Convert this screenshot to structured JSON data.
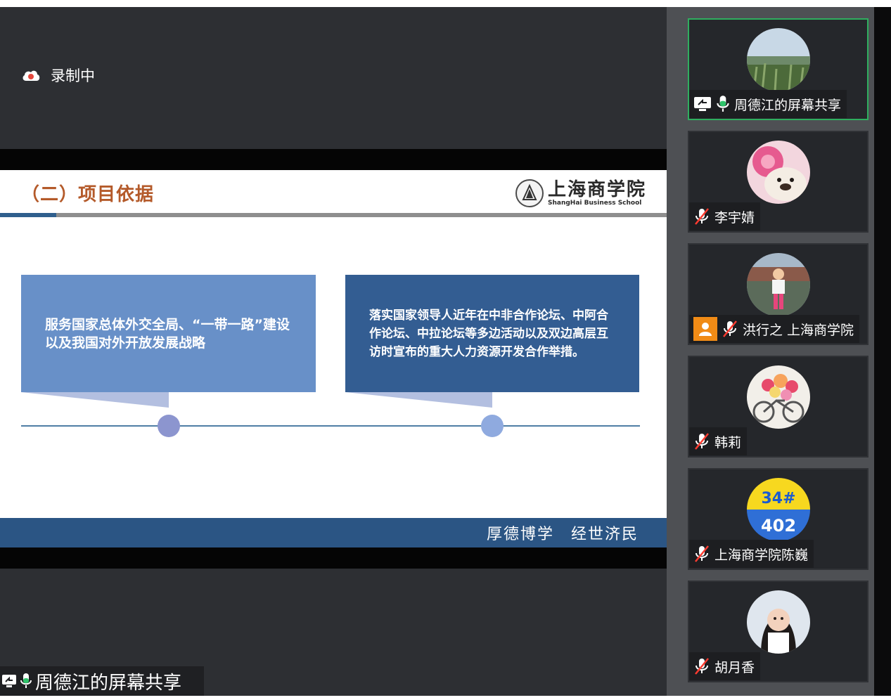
{
  "recording": {
    "label": "录制中"
  },
  "slide": {
    "title": "（二）项目依据",
    "logo_cn": "上海商学院",
    "logo_en": "ShangHai Business School",
    "box_left_text": "服务国家总体外交全局、“一带一路”建设以及我国对外开放发展战略",
    "box_right_text": "落实国家领导人近年在中非合作论坛、中阿合作论坛、中拉论坛等多边活动以及双边高层互访时宣布的重大人力资源开发合作举措。",
    "footer_motto": "厚德博学　经世济民"
  },
  "share": {
    "label": "周德江的屏幕共享"
  },
  "participants": [
    {
      "name": "周德江的屏幕共享",
      "mic": "on",
      "active": true,
      "avatar_icon": "landscape-photo"
    },
    {
      "name": "李宇婧",
      "mic": "muted",
      "active": false,
      "avatar_icon": "dog-with-flower-photo"
    },
    {
      "name": "洪行之 上海商学院",
      "mic": "muted",
      "active": false,
      "avatar_icon": "person-bridge-photo"
    },
    {
      "name": "韩莉",
      "mic": "muted",
      "active": false,
      "avatar_icon": "flower-bicycle-photo"
    },
    {
      "name": "上海商学院陈巍",
      "mic": "muted",
      "active": false,
      "avatar_icon": "number-badge",
      "avatar_text_top": "34#",
      "avatar_text_bottom": "402"
    },
    {
      "name": "胡月香",
      "mic": "muted",
      "active": false,
      "avatar_icon": "woman-portrait-photo"
    }
  ],
  "colors": {
    "stage_bg": "#2d2f33",
    "sidebar_bg": "#4e5054",
    "active_border": "#2fae5f",
    "title_color": "#b45a2a",
    "box_left": "#6890c8",
    "box_right": "#335d92",
    "footer_bg": "#2b5584"
  }
}
